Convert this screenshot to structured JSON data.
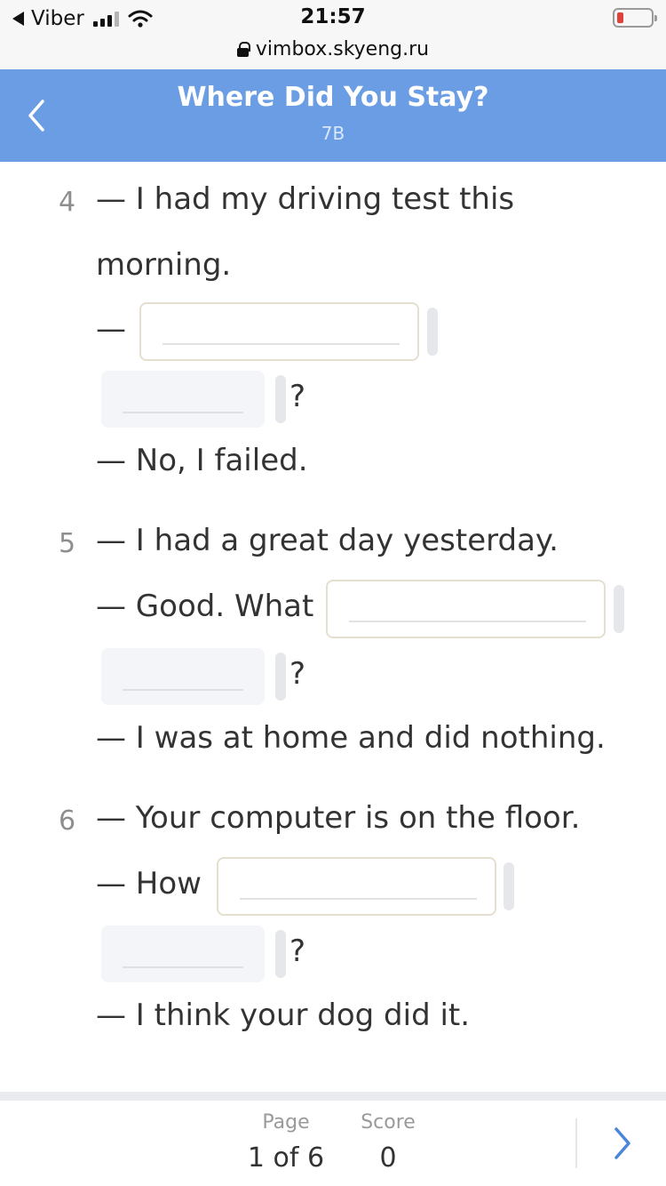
{
  "status_bar": {
    "back_app": "Viber",
    "time": "21:57",
    "url": "vimbox.skyeng.ru"
  },
  "header": {
    "title": "Where Did You Stay?",
    "subtitle": "7B"
  },
  "exercises": [
    {
      "number": "4",
      "prompt_line1": "— I had my driving test this",
      "prompt_line2": "morning.",
      "reply_prefix": "—",
      "question_mark": "?",
      "answer": "— No, I failed."
    },
    {
      "number": "5",
      "prompt_line1": "— I had a great day yesterday.",
      "reply_prefix": "— Good. What",
      "question_mark": "?",
      "answer": "— I was at home and did nothing."
    },
    {
      "number": "6",
      "prompt_line1": "— Your computer is on the floor.",
      "reply_prefix": "— How",
      "question_mark": "?",
      "answer": "— I think your dog did it."
    }
  ],
  "footer": {
    "page_label": "Page",
    "page_value": "1 of 6",
    "score_label": "Score",
    "score_value": "0"
  },
  "colors": {
    "header_bg": "#6a9de3",
    "accent": "#4a86d9",
    "text": "#333333"
  }
}
